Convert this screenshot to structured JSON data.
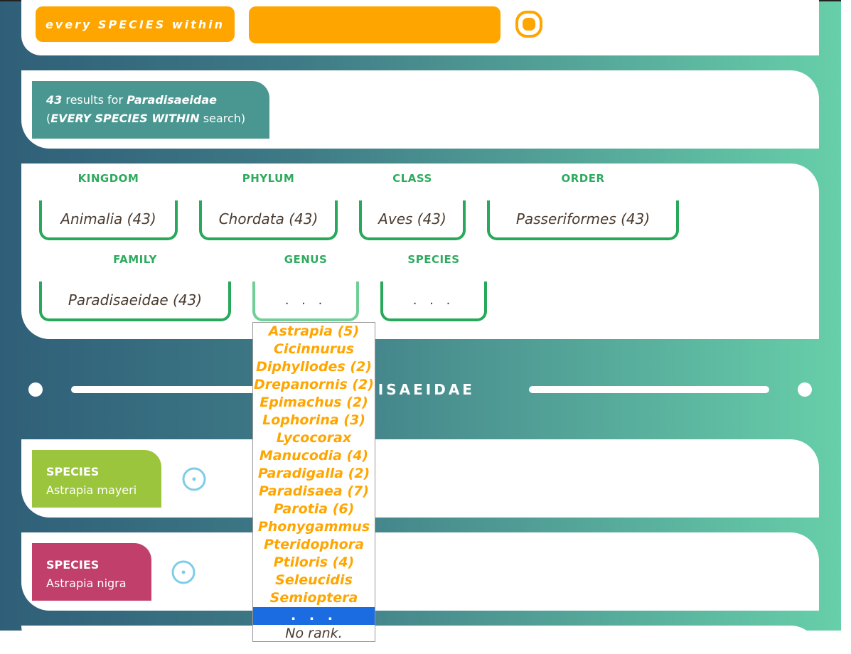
{
  "search": {
    "mode_label": "every SPECIES within",
    "query_value": ""
  },
  "results": {
    "count": "43",
    "count_suffix": " results for ",
    "query": "Paradisaeidae",
    "mode_prefix": "(",
    "mode": "EVERY SPECIES WITHIN",
    "mode_suffix": " search)"
  },
  "ranks": [
    {
      "label": "KINGDOM",
      "value": "Animalia (43)"
    },
    {
      "label": "PHYLUM",
      "value": "Chordata (43)"
    },
    {
      "label": "CLASS",
      "value": "Aves (43)"
    },
    {
      "label": "ORDER",
      "value": "Passeriformes (43)"
    },
    {
      "label": "FAMILY",
      "value": "Paradisaeidae (43)"
    },
    {
      "label": "GENUS",
      "value": ". . ."
    },
    {
      "label": "SPECIES",
      "value": ". . ."
    }
  ],
  "divider": {
    "title": "PARADISAEIDAE"
  },
  "genus_dropdown": {
    "options": [
      "Astrapia (5)",
      "Cicinnurus",
      "Diphyllodes (2)",
      "Drepanornis (2)",
      "Epimachus (2)",
      "Lophorina (3)",
      "Lycocorax",
      "Manucodia (4)",
      "Paradigalla (2)",
      "Paradisaea (7)",
      "Parotia (6)",
      "Phonygammus",
      "Pteridophora",
      "Ptiloris (4)",
      "Seleucidis",
      "Semioptera"
    ],
    "selected": ". . .",
    "no_rank": "No rank."
  },
  "species_cards": [
    {
      "type": "SPECIES",
      "name": "Astrapia mayeri",
      "color": "#9bc53d"
    },
    {
      "type": "SPECIES",
      "name": "Astrapia nigra",
      "color": "#c0406b"
    }
  ],
  "colors": {
    "accent": "#ffa500",
    "rank_green": "#28a85a",
    "results_teal": "#4a9791",
    "locate_blue": "#7dcde8"
  }
}
